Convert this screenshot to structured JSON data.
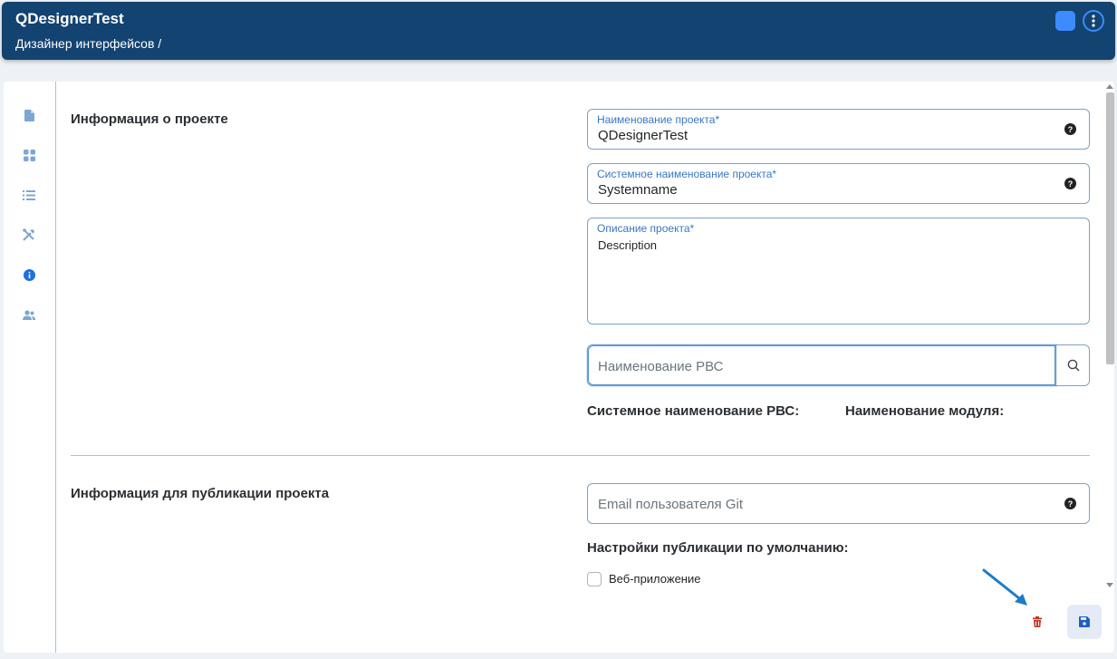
{
  "header": {
    "title": "QDesignerTest",
    "breadcrumb": "Дизайнер интерфейсов /",
    "background": "#134370"
  },
  "sidebar": {
    "items": [
      {
        "icon": "file-icon"
      },
      {
        "icon": "grid-icon"
      },
      {
        "icon": "list-icon"
      },
      {
        "icon": "tools-icon"
      },
      {
        "icon": "info-icon",
        "active": true
      },
      {
        "icon": "users-icon"
      }
    ]
  },
  "project_info": {
    "section_title": "Информация о проекте",
    "name_label": "Наименование проекта*",
    "name_value": "QDesignerTest",
    "system_name_label": "Системное наименование проекта*",
    "system_name_value": "Systemname",
    "description_label": "Описание проекта*",
    "description_value": "Description",
    "rvs_placeholder": "Наименование РВС",
    "rvs_system_name_label": "Системное наименование РВС:",
    "module_name_label": "Наименование модуля:"
  },
  "publication": {
    "section_title": "Информация для публикации проекта",
    "git_email_placeholder": "Email пользователя Git",
    "default_settings_label": "Настройки публикации по умолчанию:",
    "web_app_label": "Веб-приложение",
    "web_app_checked": false
  },
  "colors": {
    "accent": "#3d8bfd",
    "delete": "#c0392b",
    "label_blue": "#3a76c4"
  }
}
